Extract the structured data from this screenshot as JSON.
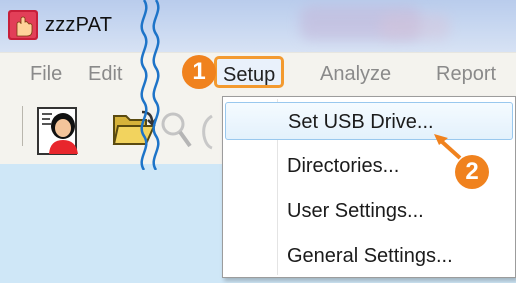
{
  "window": {
    "title": "zzzPAT"
  },
  "menubar": {
    "items": [
      {
        "label": "File"
      },
      {
        "label": "Edit"
      },
      {
        "label": "Setup"
      },
      {
        "label": "Analyze"
      },
      {
        "label": "Report"
      }
    ]
  },
  "toolbar": {
    "icons": [
      "person-card-icon",
      "folder-open-icon",
      "magnifier-icon",
      "faint-icon"
    ]
  },
  "setup_menu": {
    "items": [
      {
        "label": "Set USB Drive..."
      },
      {
        "label": "Directories..."
      },
      {
        "label": "User Settings..."
      },
      {
        "label": "General Settings..."
      }
    ],
    "highlighted": "Set USB Drive..."
  },
  "annotations": {
    "step1": "1",
    "step2": "2",
    "accent_color": "#f0821e",
    "break_line_color": "#1e74c8"
  }
}
